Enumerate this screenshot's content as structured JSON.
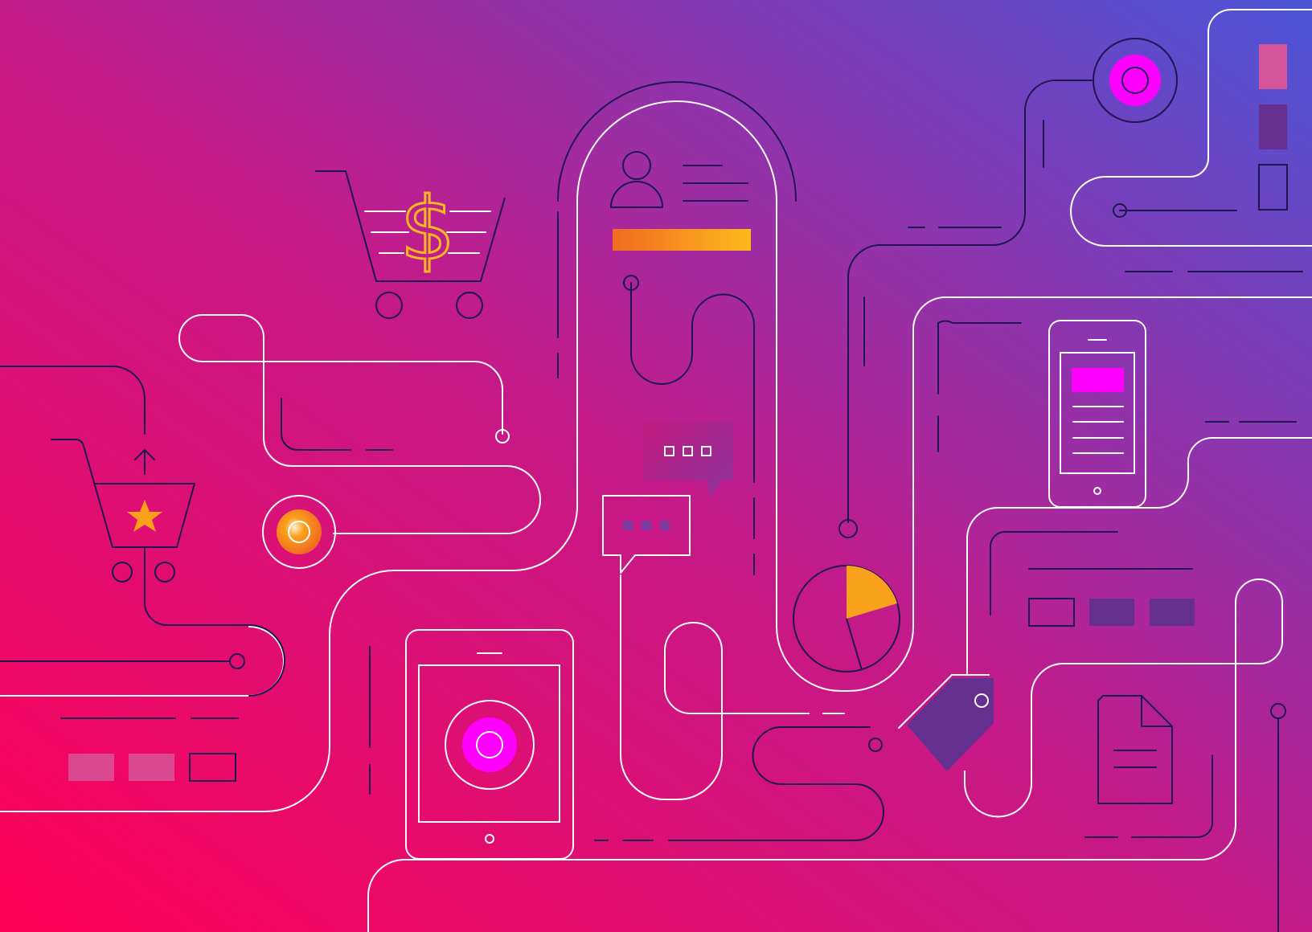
{
  "colors": {
    "gradient_bottom_left": "#ff0055",
    "gradient_mid": "#c41a8a",
    "gradient_top_right": "#4a55d8",
    "white_line": "#ffffff",
    "navy_line": "#1e1650",
    "magenta": "#ff00ff",
    "orange": "#f9a11b",
    "orange_dark": "#f26a21",
    "purple_block": "#65308f",
    "pink_block": "#d6559a",
    "violet_block": "#6a3399"
  },
  "icons": [
    "shopping-cart-dollar-icon",
    "shopping-cart-star-icon",
    "user-profile-icon",
    "chat-bubble-icon",
    "pie-chart-icon",
    "smartphone-icon",
    "tablet-icon",
    "price-tag-icon",
    "document-icon",
    "target-button-icon"
  ],
  "pie_chart": {
    "highlighted_slice_fraction": 0.21
  },
  "progress_bar": {
    "fill_fraction": 1.0
  }
}
